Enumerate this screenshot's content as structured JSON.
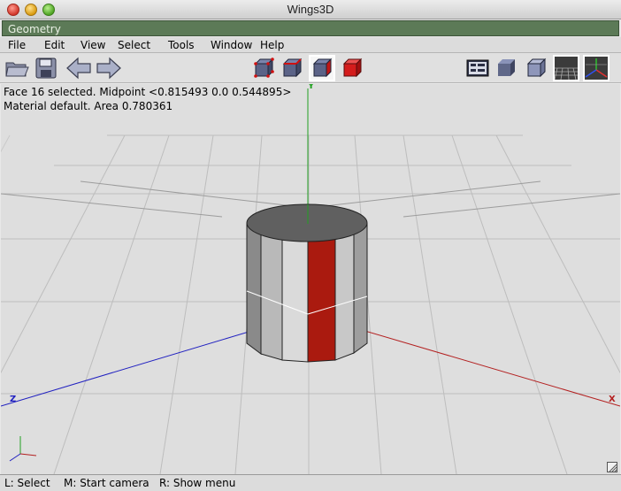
{
  "window": {
    "title": "Wings3D"
  },
  "geometry_bar": {
    "label": "Geometry"
  },
  "menu": [
    "File",
    "Edit",
    "View",
    "Select",
    "Tools",
    "Window",
    "Help"
  ],
  "toolbar": {
    "left_icons": [
      "open-folder-icon",
      "save-disk-icon",
      "undo-arrow-icon",
      "redo-arrow-icon"
    ],
    "selection_modes": [
      "vertex-mode-icon",
      "edge-mode-icon",
      "face-mode-icon",
      "body-mode-icon"
    ],
    "selected_mode": "face-mode-icon",
    "right_icons": [
      "groundplane-toggle-icon",
      "smooth-shading-icon",
      "flat-shading-icon",
      "axes-icon",
      "perspective-grid-icon"
    ]
  },
  "viewport": {
    "info_line1": "Face 16 selected. Midpoint <0.815493  0.0  0.544895>",
    "info_line2": "Material default. Area 0.780361",
    "axis_y": "Y",
    "axis_z": "Z",
    "axis_x": "X",
    "selection_color": "#aa1a0f",
    "axis_colors": {
      "x": "#b32020",
      "y": "#22a022",
      "z": "#2020c0"
    }
  },
  "status": {
    "left": "L: Select",
    "middle": "M: Start camera",
    "right": "R: Show menu"
  }
}
